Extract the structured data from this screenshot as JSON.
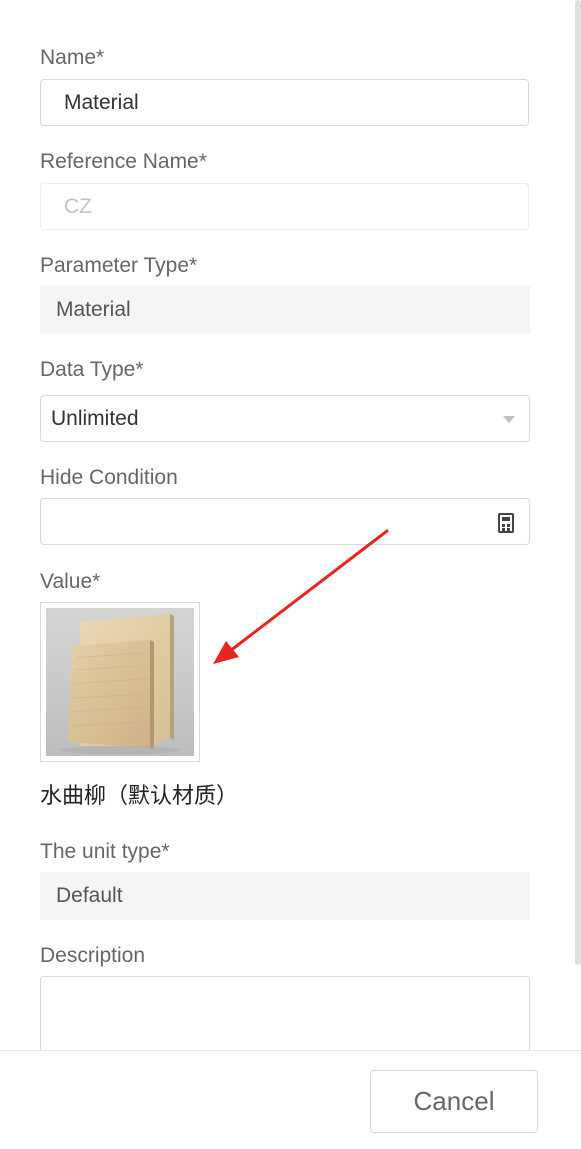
{
  "form": {
    "name": {
      "label": "Name*",
      "value": "Material"
    },
    "reference_name": {
      "label": "Reference Name*",
      "placeholder": "CZ"
    },
    "parameter_type": {
      "label": "Parameter Type*",
      "value": "Material"
    },
    "data_type": {
      "label": "Data Type*",
      "value": "Unlimited"
    },
    "hide_condition": {
      "label": "Hide Condition",
      "value": ""
    },
    "value": {
      "label": "Value*",
      "material_name": "水曲柳（默认材质）"
    },
    "unit_type": {
      "label": "The unit type*",
      "value": "Default"
    },
    "description": {
      "label": "Description",
      "value": ""
    }
  },
  "footer": {
    "cancel_label": "Cancel"
  },
  "icons": {
    "data_type_caret": "chevron-down-icon",
    "hide_condition_calculator": "calculator-icon",
    "annotation": "red-arrow"
  },
  "colors": {
    "annotation_arrow": "#e8261f",
    "readonly_background": "#f5f5f5",
    "border": "#d9d9d9"
  }
}
